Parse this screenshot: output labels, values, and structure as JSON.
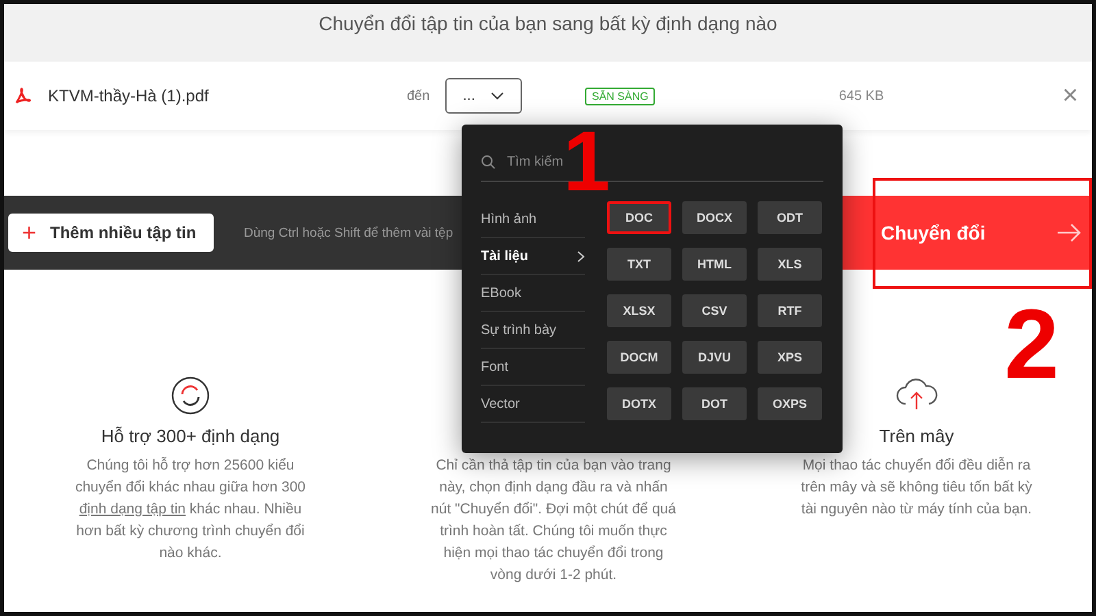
{
  "header": {
    "title": "Chuyển đổi tập tin của bạn sang bất kỳ định dạng nào"
  },
  "file_row": {
    "name": "KTVM-thầy-Hà (1).pdf",
    "to_label": "đến",
    "format_select": "...",
    "status": "SẴN SÀNG",
    "size": "645 KB",
    "close": "×"
  },
  "action_bar": {
    "add_button": "Thêm nhiều tập tin",
    "plus": "+",
    "hint": "Dùng Ctrl hoặc Shift để thêm vài tệp",
    "convert_button": {
      "label": "Chuyển đổi",
      "marked": true
    }
  },
  "features": [
    {
      "kind": "refresh",
      "title": "Hỗ trợ 300+ định dạng",
      "text": "Chúng tôi hỗ trợ hơn 25600 kiểu chuyển đổi khác nhau giữa hơn 300 ",
      "link": "định dạng tập tin",
      "text_after": " khác nhau. Nhiều hơn bất kỳ chương trình chuyển đổi nào khác."
    },
    {
      "kind": "none",
      "text": "Chỉ cần thả tập tin của bạn vào trang này, chọn định dạng đầu ra và nhấn nút \"Chuyển đổi\". Đợi một chút để quá trình hoàn tất. Chúng tôi muốn thực hiện mọi thao tác chuyển đổi trong vòng dưới 1-2 phút."
    },
    {
      "kind": "cloud",
      "title": "Trên mây",
      "text": "Mọi thao tác chuyển đổi đều diễn ra trên mây và sẽ không tiêu tốn bất kỳ tài nguyên nào từ máy tính của bạn."
    }
  ],
  "dropdown": {
    "search_placeholder": "Tìm kiếm",
    "categories": [
      {
        "label": "Hình ảnh",
        "selected": false
      },
      {
        "label": "Tài liệu",
        "selected": true
      },
      {
        "label": "EBook",
        "selected": false
      },
      {
        "label": "Sự trình bày",
        "selected": false
      },
      {
        "label": "Font",
        "selected": false
      },
      {
        "label": "Vector",
        "selected": false
      }
    ],
    "formats": [
      {
        "label": "DOC",
        "marked": true
      },
      {
        "label": "DOCX",
        "marked": false
      },
      {
        "label": "ODT",
        "marked": false
      },
      {
        "label": "TXT",
        "marked": false
      },
      {
        "label": "HTML",
        "marked": false
      },
      {
        "label": "XLS",
        "marked": false
      },
      {
        "label": "XLSX",
        "marked": false
      },
      {
        "label": "CSV",
        "marked": false
      },
      {
        "label": "RTF",
        "marked": false
      },
      {
        "label": "DOCM",
        "marked": false
      },
      {
        "label": "DJVU",
        "marked": false
      },
      {
        "label": "XPS",
        "marked": false
      },
      {
        "label": "DOTX",
        "marked": false
      },
      {
        "label": "DOT",
        "marked": false
      },
      {
        "label": "OXPS",
        "marked": false
      }
    ]
  },
  "annotations": [
    {
      "label": "1"
    },
    {
      "label": "2"
    }
  ]
}
